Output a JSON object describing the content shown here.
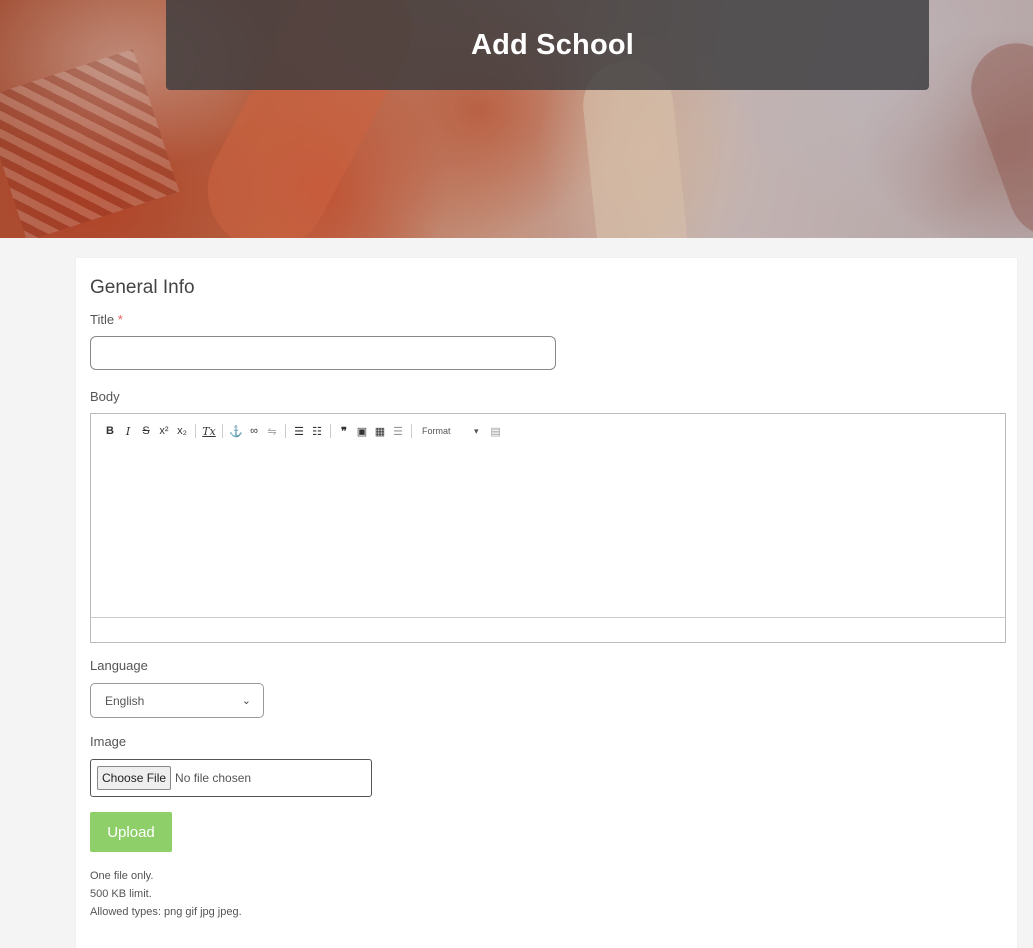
{
  "page": {
    "title": "Add School"
  },
  "form": {
    "section_title": "General Info",
    "title_label": "Title",
    "required_marker": "*",
    "title_value": "",
    "body_label": "Body",
    "editor_toolbar": {
      "bold": "B",
      "italic": "I",
      "strike": "S",
      "superscript": "x²",
      "subscript": "x₂",
      "remove_format": "Tx",
      "anchor": "⚓",
      "link": "∞",
      "unlink": "⇋",
      "bulleted_list": "☰",
      "numbered_list": "☷",
      "blockquote": "❞",
      "image": "▣",
      "table": "▦",
      "horizontal_rule": "☰",
      "format_label": "Format",
      "format_caret": "▾",
      "source": "▤"
    },
    "language_label": "Language",
    "language_value": "English",
    "image_label": "Image",
    "choose_file_label": "Choose File",
    "no_file_text": "No file chosen",
    "upload_label": "Upload",
    "help_lines": [
      "One file only.",
      "500 KB limit.",
      "Allowed types: png gif jpg jpeg."
    ]
  },
  "colors": {
    "upload_button": "#8fcf6a",
    "required": "#e06060",
    "title_bar": "#3c3c3e"
  }
}
